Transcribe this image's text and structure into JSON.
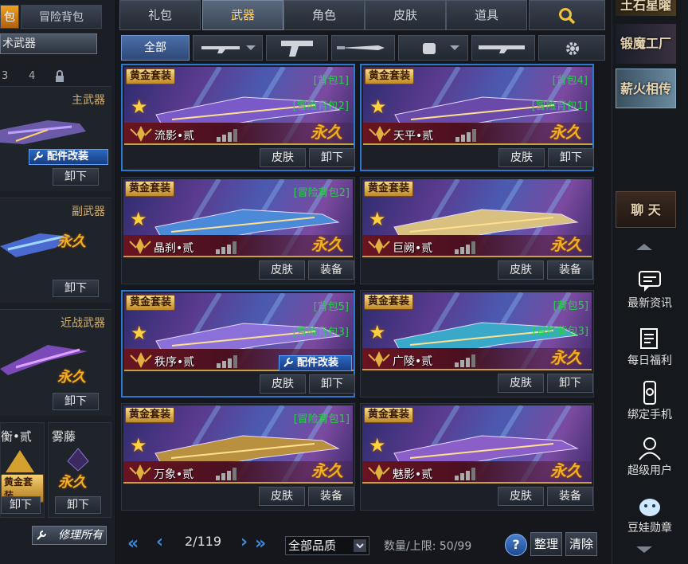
{
  "left": {
    "tab_partial": "包",
    "tab_adventure_bag": "冒险背包",
    "selector": "术武器",
    "bag_numbers": [
      "3",
      "4"
    ],
    "primary_label": "主武器",
    "secondary_label": "副武器",
    "melee_label": "近战武器",
    "fitting_label": "配件改装",
    "unload_label": "卸下",
    "permanent_label": "永久",
    "slot_a_name": "衡•贰",
    "slot_b_name": "雾藤",
    "gold_set_label": "黄金套装",
    "repair_all_label": "修理所有"
  },
  "tabs": [
    "礼包",
    "武器",
    "角色",
    "皮肤",
    "道具"
  ],
  "active_tab": "武器",
  "subtabs": {
    "all_label": "全部"
  },
  "cards": [
    {
      "badge": "黄金套装",
      "name": "流影•贰",
      "tags": [
        "[背包1]",
        "[冒险背包2]"
      ],
      "permanent": "永久",
      "buttons": [
        "皮肤",
        "卸下"
      ],
      "selected": true,
      "fitting": false
    },
    {
      "badge": "黄金套装",
      "name": "天平•贰",
      "tags": [
        "[背包4]",
        "[冒险背包1]"
      ],
      "permanent": "永久",
      "buttons": [
        "皮肤",
        "卸下"
      ],
      "selected": true,
      "fitting": false
    },
    {
      "badge": "黄金套装",
      "name": "晶刹•贰",
      "tags": [
        "[冒险背包2]"
      ],
      "permanent": "永久",
      "buttons": [
        "皮肤",
        "装备"
      ],
      "selected": false,
      "fitting": false
    },
    {
      "badge": "黄金套装",
      "name": "巨阙•贰",
      "tags": [],
      "permanent": "永久",
      "buttons": [
        "皮肤",
        "装备"
      ],
      "selected": false,
      "fitting": false
    },
    {
      "badge": "黄金套装",
      "name": "秩序•贰",
      "tags": [
        "[背包5]",
        "[冒险背包3]"
      ],
      "permanent": "",
      "fitting_label": "配件改装",
      "buttons": [
        "皮肤",
        "卸下"
      ],
      "selected": true,
      "fitting": true
    },
    {
      "badge": "黄金套装",
      "name": "广陵•贰",
      "tags": [
        "[背包5]",
        "[冒险背包3]"
      ],
      "permanent": "永久",
      "buttons": [
        "皮肤",
        "卸下"
      ],
      "selected": false,
      "fitting": false
    },
    {
      "badge": "黄金套装",
      "name": "万象•贰",
      "tags": [
        "[冒险背包1]"
      ],
      "permanent": "永久",
      "buttons": [
        "皮肤",
        "装备"
      ],
      "selected": false,
      "fitting": false
    },
    {
      "badge": "黄金套装",
      "name": "魅影•贰",
      "tags": [],
      "permanent": "永久",
      "buttons": [
        "皮肤",
        "装备"
      ],
      "selected": false,
      "fitting": false
    }
  ],
  "pagination": {
    "page": "2/119"
  },
  "quality_filter": "全部品质",
  "count_text": "数量/上限: 50/99",
  "organize_label": "整理",
  "clear_label": "清除",
  "help_label": "?",
  "right": {
    "banners": [
      "土石星曜",
      "锻魔工厂",
      "薪火相传"
    ],
    "chat_label": "聊 天",
    "items": [
      "最新资讯",
      "每日福利",
      "绑定手机",
      "超级用户",
      "豆娃勋章"
    ]
  },
  "colors": {
    "accent_gold": "#f0b020",
    "tag_green": "#28d048",
    "selected_border": "#2a78d0"
  }
}
